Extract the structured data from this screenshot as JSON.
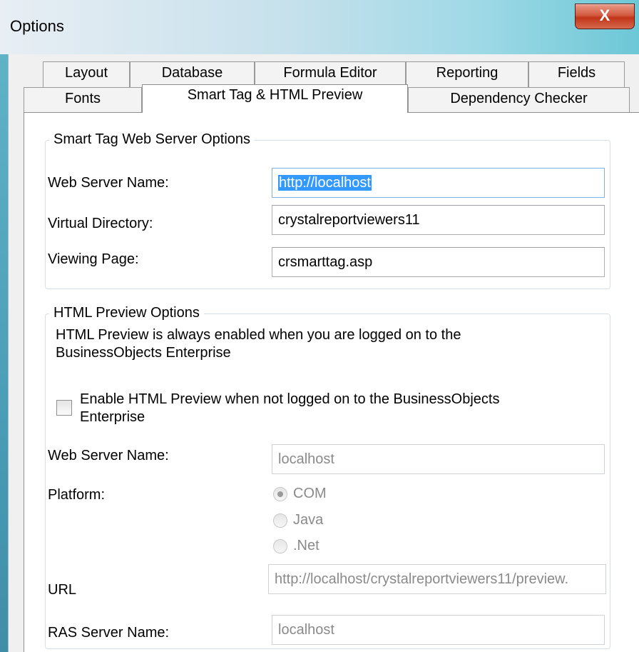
{
  "window": {
    "title": "Options",
    "close_glyph": "X"
  },
  "tabs_row1": [
    "Layout",
    "Database",
    "Formula Editor",
    "Reporting",
    "Fields"
  ],
  "tabs_row2": [
    "Fonts",
    "Smart Tag & HTML Preview",
    "Dependency Checker"
  ],
  "active_tab": "Smart Tag & HTML Preview",
  "smart_tag": {
    "group_label": "Smart Tag Web Server Options",
    "web_server_label": "Web Server Name:",
    "web_server_value": "http://localhost",
    "virtual_dir_label": "Virtual Directory:",
    "virtual_dir_value": "crystalreportviewers11",
    "viewing_page_label": "Viewing Page:",
    "viewing_page_value": "crsmarttag.asp"
  },
  "html_preview": {
    "group_label": "HTML Preview Options",
    "info_line1": "HTML Preview is always enabled when you are logged on to the",
    "info_line2": "BusinessObjects Enterprise",
    "enable_label_line1": "Enable HTML Preview when not logged on to the BusinessObjects",
    "enable_label_line2": "Enterprise",
    "enable_checked": false,
    "web_server_label": "Web Server Name:",
    "web_server_value": "localhost",
    "platform_label": "Platform:",
    "platform_options": [
      "COM",
      "Java",
      ".Net"
    ],
    "platform_selected": "COM",
    "url_label": "URL",
    "url_value": "http://localhost/crystalreportviewers11/preview.",
    "ras_label": "RAS Server Name:",
    "ras_value": "localhost"
  },
  "colors": {
    "selection": "#3399ff",
    "close_button": "#c13417",
    "disabled_text": "#8a8a8a"
  }
}
